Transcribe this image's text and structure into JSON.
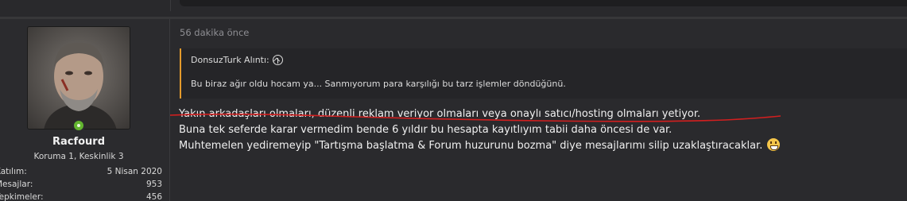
{
  "user": {
    "username": "Racfourd",
    "title": "Koruma 1, Keskinlik 3",
    "stats": [
      {
        "label": "Katılım:",
        "value": "5 Nisan 2020"
      },
      {
        "label": "Mesajlar:",
        "value": "953"
      },
      {
        "label": "Tepkimeler:",
        "value": "456"
      }
    ],
    "online_color": "#63b52f"
  },
  "post": {
    "time": "56 dakika önce",
    "quote": {
      "author": "DonsuzTurk",
      "suffix": " Alıntı:",
      "body": "Bu biraz ağır oldu hocam ya... Sanmıyorum para karşılığı bu tarz işlemler döndüğünü."
    },
    "lines": [
      "Yakın arkadaşları olmaları, düzenli reklam veriyor olmaları veya onaylı satıcı/hosting olmaları yetiyor.",
      "Buna tek seferde karar vermedim bende 6 yıldır bu hesapta kayıtlıyım tabii daha öncesi de var.",
      "Muhtemelen yediremeyip \"Tartışma başlatma & Forum huzurunu bozma\" diye mesajlarımı silip uzaklaştıracaklar."
    ],
    "emoji": "grinning-face"
  },
  "colors": {
    "quote_accent": "#e59b2c",
    "annotation_red": "#d21f1f"
  }
}
